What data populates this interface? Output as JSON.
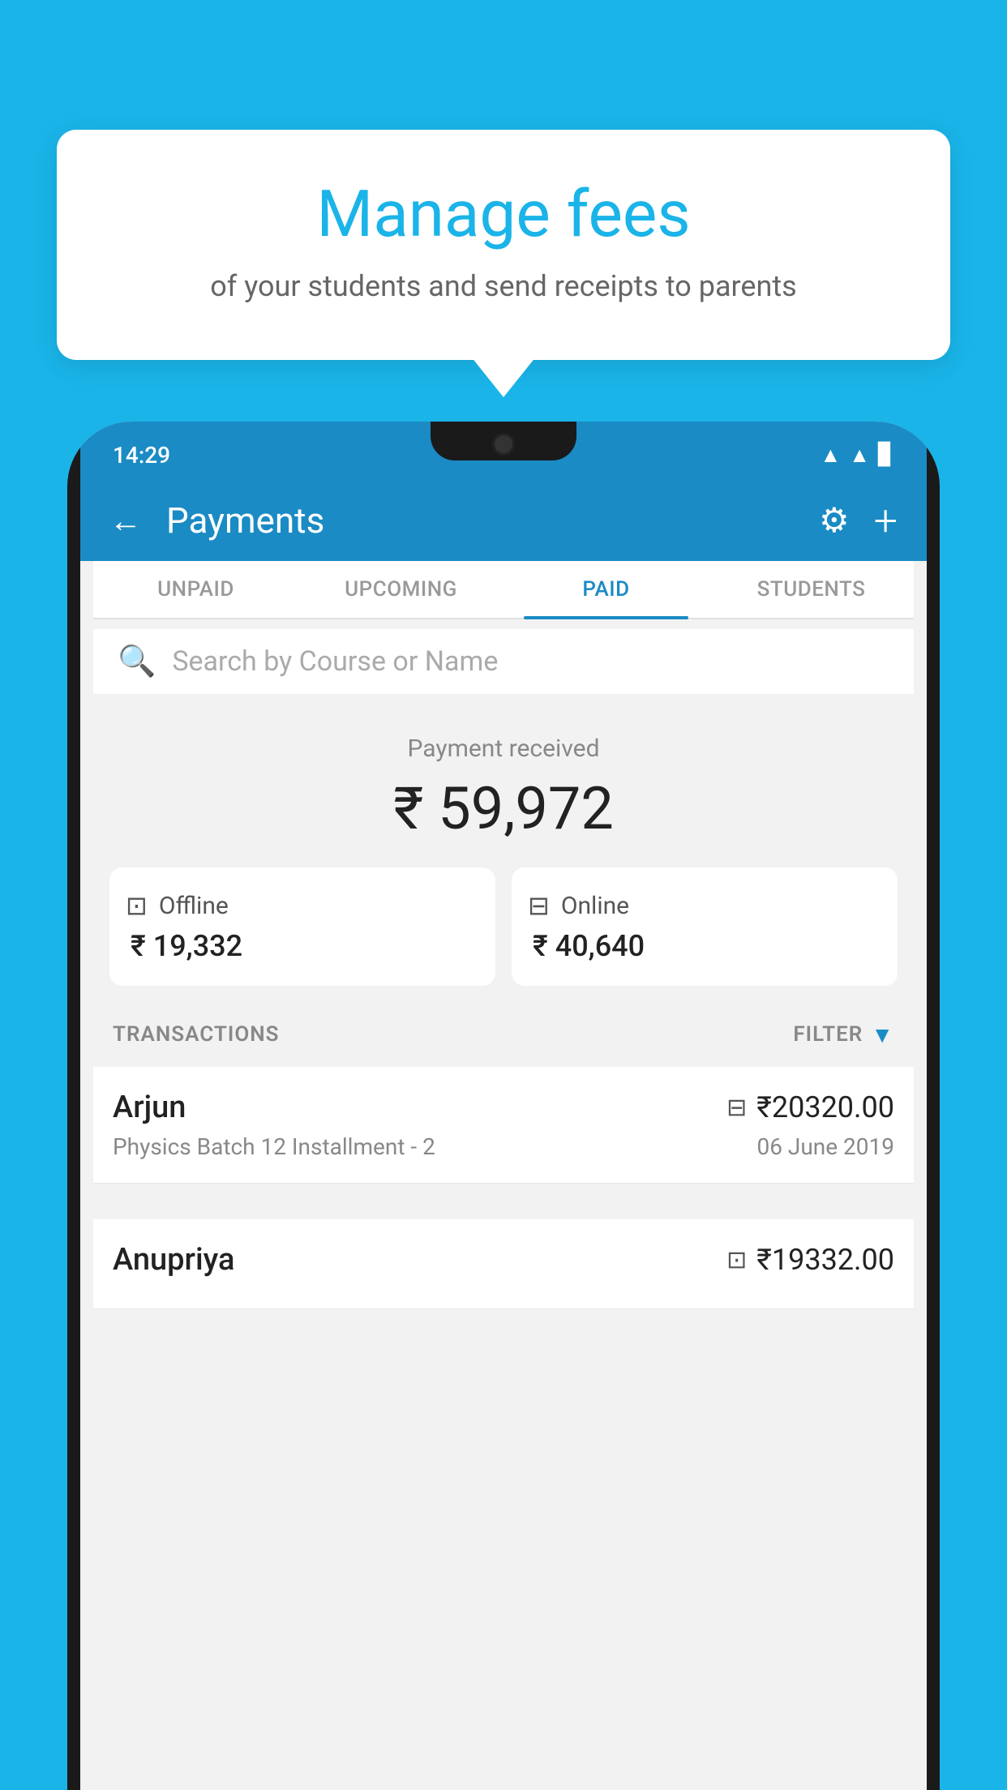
{
  "bubble": {
    "title": "Manage fees",
    "subtitle": "of your students and send receipts to parents"
  },
  "statusBar": {
    "time": "14:29",
    "icons": [
      "wifi",
      "signal",
      "battery"
    ]
  },
  "appBar": {
    "title": "Payments",
    "back_label": "←",
    "settings_label": "⚙",
    "add_label": "+"
  },
  "tabs": [
    {
      "label": "UNPAID",
      "active": false
    },
    {
      "label": "UPCOMING",
      "active": false
    },
    {
      "label": "PAID",
      "active": true
    },
    {
      "label": "STUDENTS",
      "active": false
    }
  ],
  "search": {
    "placeholder": "Search by Course or Name"
  },
  "payment": {
    "received_label": "Payment received",
    "total": "₹ 59,972",
    "offline_label": "Offline",
    "offline_amount": "₹ 19,332",
    "online_label": "Online",
    "online_amount": "₹ 40,640"
  },
  "transactions": {
    "header_label": "TRANSACTIONS",
    "filter_label": "FILTER",
    "rows": [
      {
        "name": "Arjun",
        "amount": "₹20320.00",
        "detail": "Physics Batch 12 Installment - 2",
        "date": "06 June 2019",
        "type": "online"
      },
      {
        "name": "Anupriya",
        "amount": "₹19332.00",
        "detail": "",
        "date": "",
        "type": "offline"
      }
    ]
  }
}
